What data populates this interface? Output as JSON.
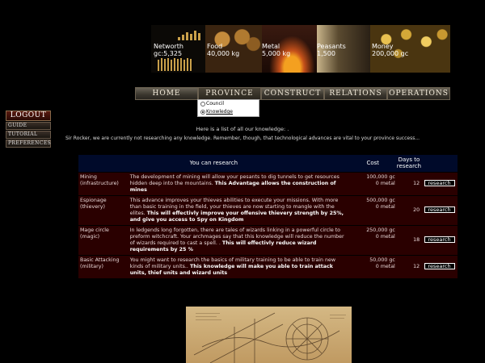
{
  "resources": [
    {
      "name": "Networth",
      "value": "gc:5,325"
    },
    {
      "name": "Food",
      "value": "40,000 kg"
    },
    {
      "name": "Metal",
      "value": "5,000 kg"
    },
    {
      "name": "Peasants",
      "value": "1,500"
    },
    {
      "name": "Money",
      "value": "200,000 gc"
    }
  ],
  "left_menu": {
    "logout": "LOGOUT",
    "items": [
      "GUIDE",
      "TUTORIAL",
      "PREFERENCES"
    ]
  },
  "nav": {
    "items": [
      "HOME",
      "PROVINCE",
      "CONSTRUCT",
      "RELATIONS",
      "OPERATIONS"
    ],
    "active": "PROVINCE"
  },
  "dropdown": {
    "items": [
      {
        "label": "Council",
        "selected": false
      },
      {
        "label": "Knowledge",
        "selected": true
      }
    ]
  },
  "intro": "Here is a list of all our knowledge: .",
  "status": "Sir Rocker, we are currently not researching any knowledge. Remember, though, that technological advances are vital to your province success...",
  "table": {
    "headers": {
      "research": "You can research",
      "cost": "Cost",
      "days": "Days to research"
    },
    "rows": [
      {
        "name": "Mining",
        "category": "(infrastructure)",
        "desc": "The development of mining will allow your pesants to dig tunnels to get resources hidden deep into the mountains.",
        "bold": "This Advantage allows the construction of mines",
        "cost_gc": "100,000 gc",
        "cost_metal": "0 metal",
        "days": "12",
        "button": "research"
      },
      {
        "name": "Espionage",
        "category": "(thievery)",
        "desc": "This advance improves your thieves abilities to execute your missions. With more than basic training in the field, your thieves are now starting to mangle with the elites.",
        "bold": "This will effectivly improve your offensive thievery strength by 25%, and give you access to Spy on Kingdom",
        "cost_gc": "500,000 gc",
        "cost_metal": "0 metal",
        "days": "20",
        "button": "research"
      },
      {
        "name": "Mage circle",
        "category": "(magic)",
        "desc": "In ledgends long forgotten, there are tales of wizards linking in a powerful circle to preform witchcraft. Your archmages say that this knowledge will reduce the number of wizards required to cast a spell. .",
        "bold": "This will effectivly reduce wizard requirements by 25 %",
        "cost_gc": "250,000 gc",
        "cost_metal": "0 metal",
        "days": "18",
        "button": "research"
      },
      {
        "name": "Basic Attacking",
        "category": "(military)",
        "desc": "You might want to research the basics of military training to be able to train new kinds of military units..",
        "bold": "This knowledge will make you able to train attack units, thief units and wizard units",
        "cost_gc": "50,000 gc",
        "cost_metal": "0 metal",
        "days": "12",
        "button": "research"
      }
    ]
  }
}
